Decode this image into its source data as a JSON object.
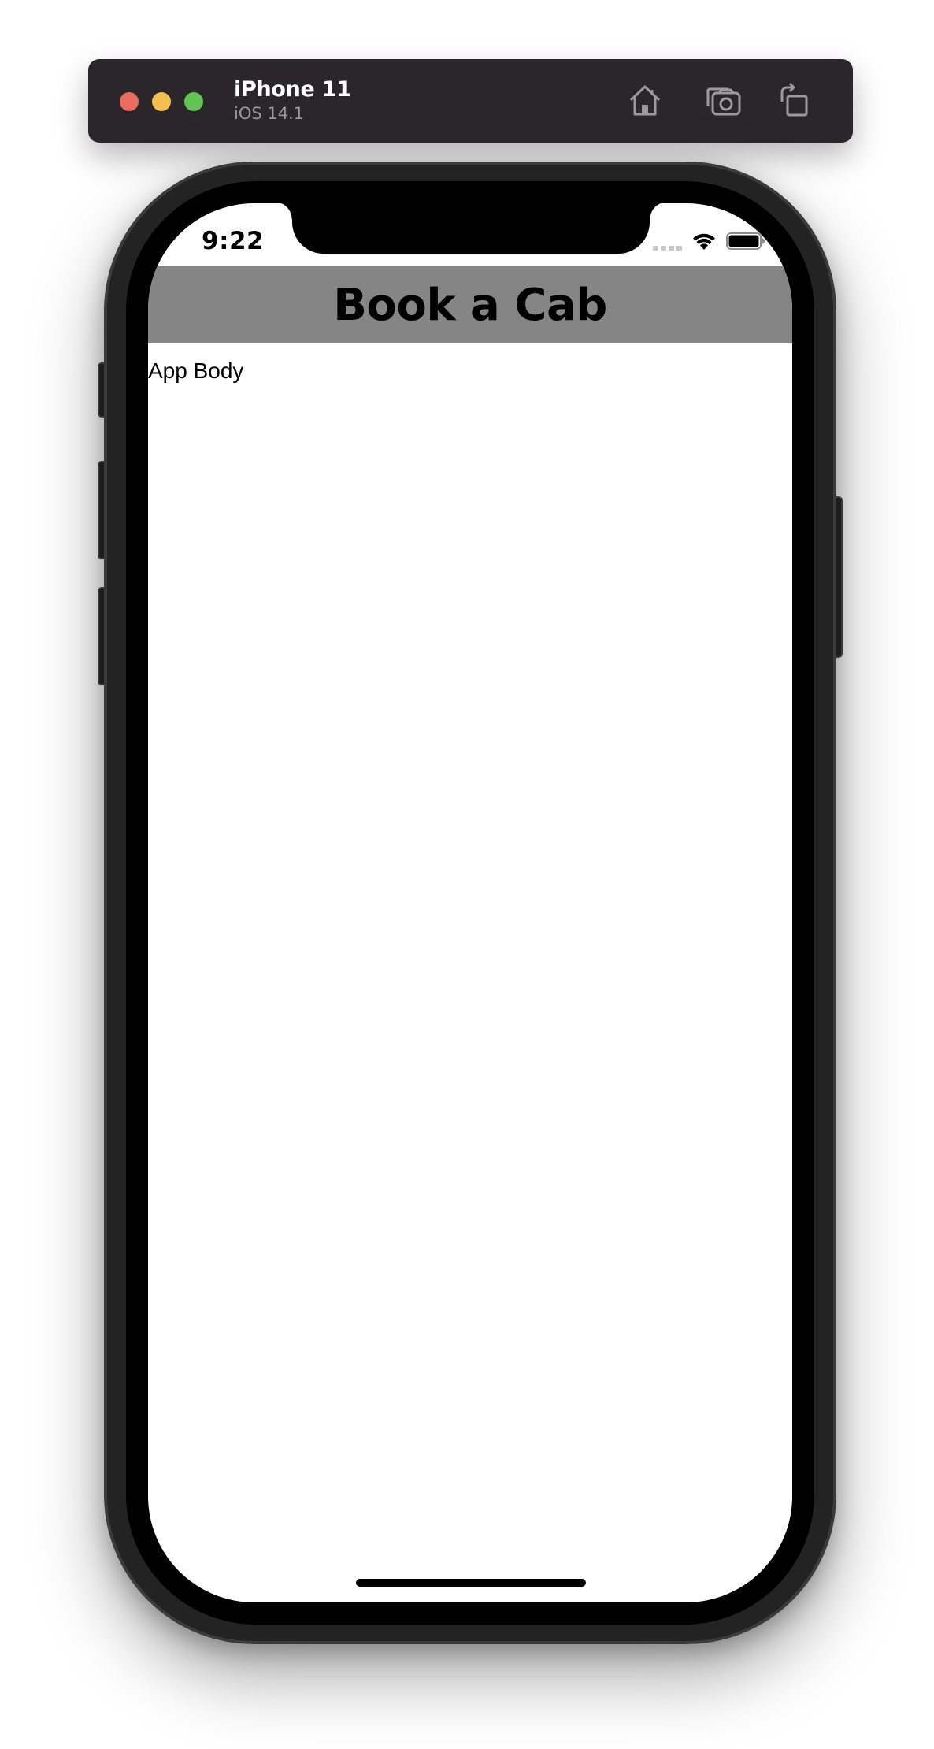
{
  "simulator": {
    "device_name": "iPhone 11",
    "os_version": "iOS 14.1",
    "controls": {
      "close": "close-button",
      "minimize": "minimize-button",
      "zoom": "zoom-button"
    },
    "toolbar_icons": [
      "home-icon",
      "screenshot-icon",
      "rotate-icon"
    ],
    "colors": {
      "toolbar_bg": "#2a2629",
      "close": "#ec6a5e",
      "minimize": "#f4bf4f",
      "zoom": "#61c554"
    }
  },
  "status_bar": {
    "time": "9:22",
    "icons": [
      "cellular-signal-icon",
      "wifi-icon",
      "battery-icon"
    ]
  },
  "app": {
    "header": {
      "title": "Book a Cab",
      "background": "#858585"
    },
    "body": {
      "text": "App Body"
    }
  }
}
